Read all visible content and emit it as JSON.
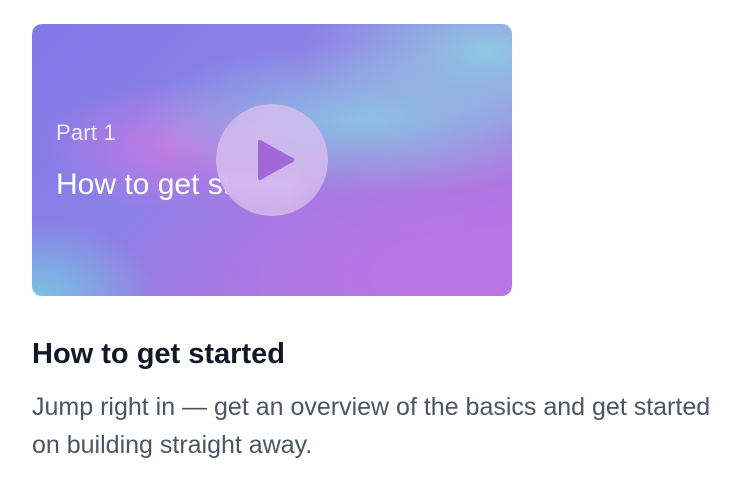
{
  "video_card": {
    "thumbnail": {
      "part_label": "Part 1",
      "title_overlay": "How to get started",
      "play_icon": "play-icon"
    },
    "title": "How to get started",
    "description": "Jump right in — get an overview of the basics and get started on building straight away."
  },
  "colors": {
    "title": "#111827",
    "description": "#4b5563",
    "gradient_purple": "#8278e6",
    "gradient_cyan": "#8acee4",
    "gradient_magenta": "#b576e4"
  }
}
